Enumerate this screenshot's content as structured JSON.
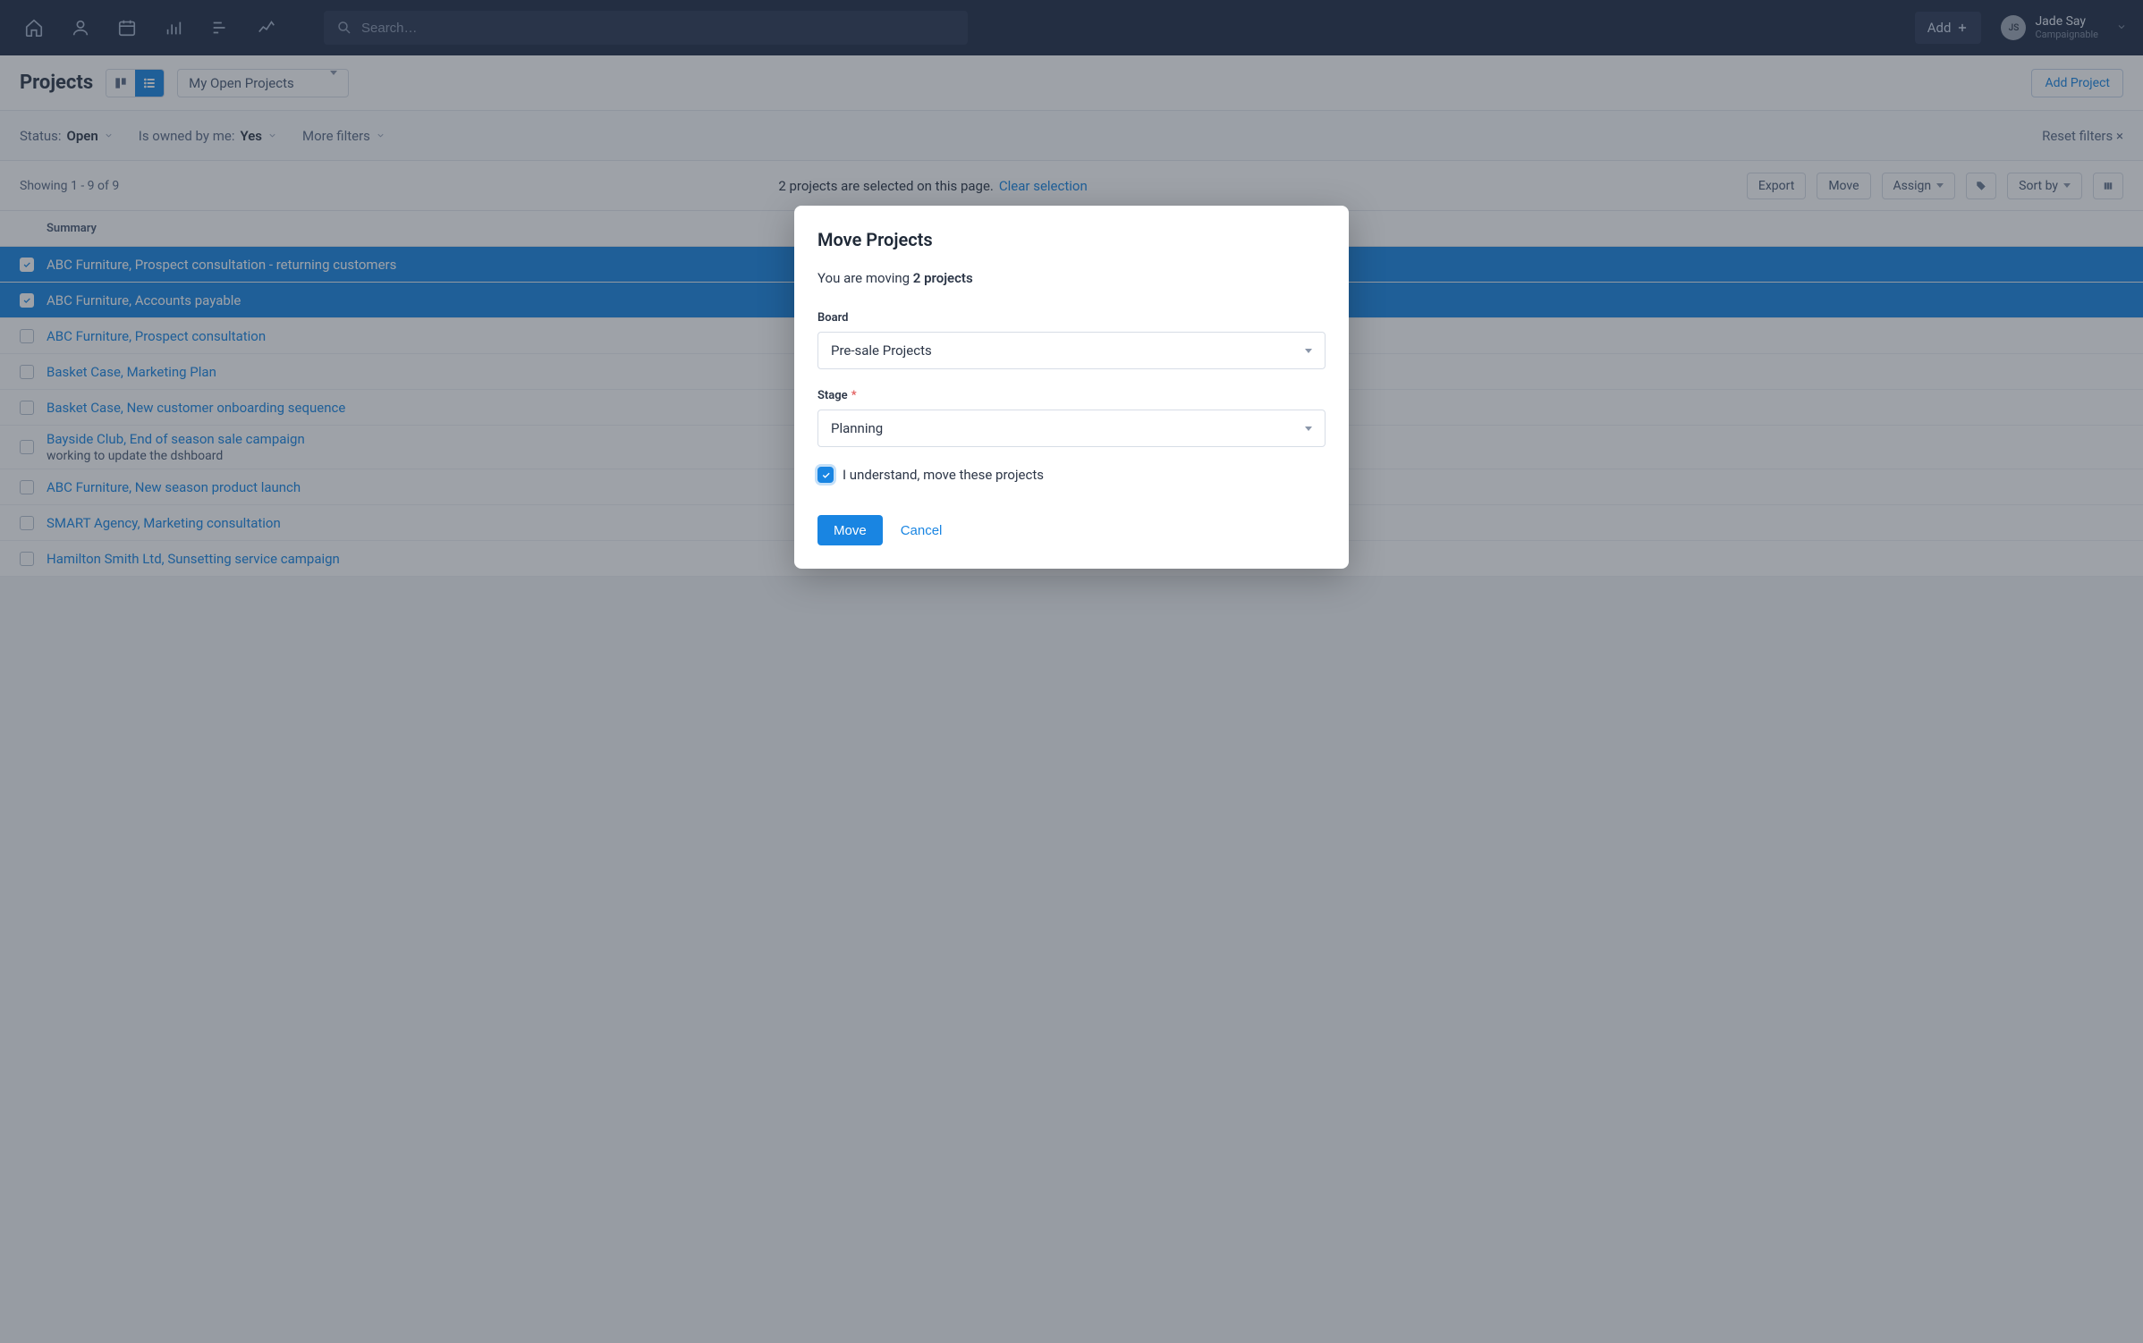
{
  "nav": {
    "search_placeholder": "Search…",
    "add_label": "Add",
    "user_name": "Jade Say",
    "user_org": "Campaignable",
    "avatar_initials": "JS"
  },
  "subheader": {
    "title": "Projects",
    "view_filter": "My Open Projects",
    "add_project": "Add Project"
  },
  "filters": {
    "status_label": "Status:",
    "status_value": "Open",
    "owned_label": "Is owned by me:",
    "owned_value": "Yes",
    "more_filters": "More filters",
    "reset": "Reset filters ×"
  },
  "toolbar": {
    "showing": "Showing 1 - 9 of 9",
    "selection_text": "2 projects are selected on this page.",
    "clear_selection": "Clear selection",
    "export": "Export",
    "move": "Move",
    "assign": "Assign",
    "sort_by": "Sort by"
  },
  "table": {
    "header_summary": "Summary",
    "rows": [
      {
        "selected": true,
        "summary": "ABC Furniture, Prospect consultation - returning customers",
        "sub": ""
      },
      {
        "selected": true,
        "summary": "ABC Furniture, Accounts payable",
        "sub": ""
      },
      {
        "selected": false,
        "summary": "ABC Furniture, Prospect consultation",
        "sub": ""
      },
      {
        "selected": false,
        "summary": "Basket Case, Marketing Plan",
        "sub": ""
      },
      {
        "selected": false,
        "summary": "Basket Case, New customer onboarding sequence",
        "sub": ""
      },
      {
        "selected": false,
        "summary": "Bayside Club, End of season sale campaign",
        "sub": "working to update the dshboard"
      },
      {
        "selected": false,
        "summary": "ABC Furniture, New season product launch",
        "sub": ""
      },
      {
        "selected": false,
        "summary": "SMART Agency, Marketing consultation",
        "sub": ""
      },
      {
        "selected": false,
        "summary": "Hamilton Smith Ltd, Sunsetting service campaign",
        "sub": ""
      }
    ]
  },
  "modal": {
    "title": "Move Projects",
    "msg_prefix": "You are moving ",
    "msg_bold": "2 projects",
    "board_label": "Board",
    "board_value": "Pre-sale Projects",
    "stage_label": "Stage",
    "stage_required": "*",
    "stage_value": "Planning",
    "confirm_text": "I understand, move these projects",
    "move_btn": "Move",
    "cancel_btn": "Cancel"
  }
}
